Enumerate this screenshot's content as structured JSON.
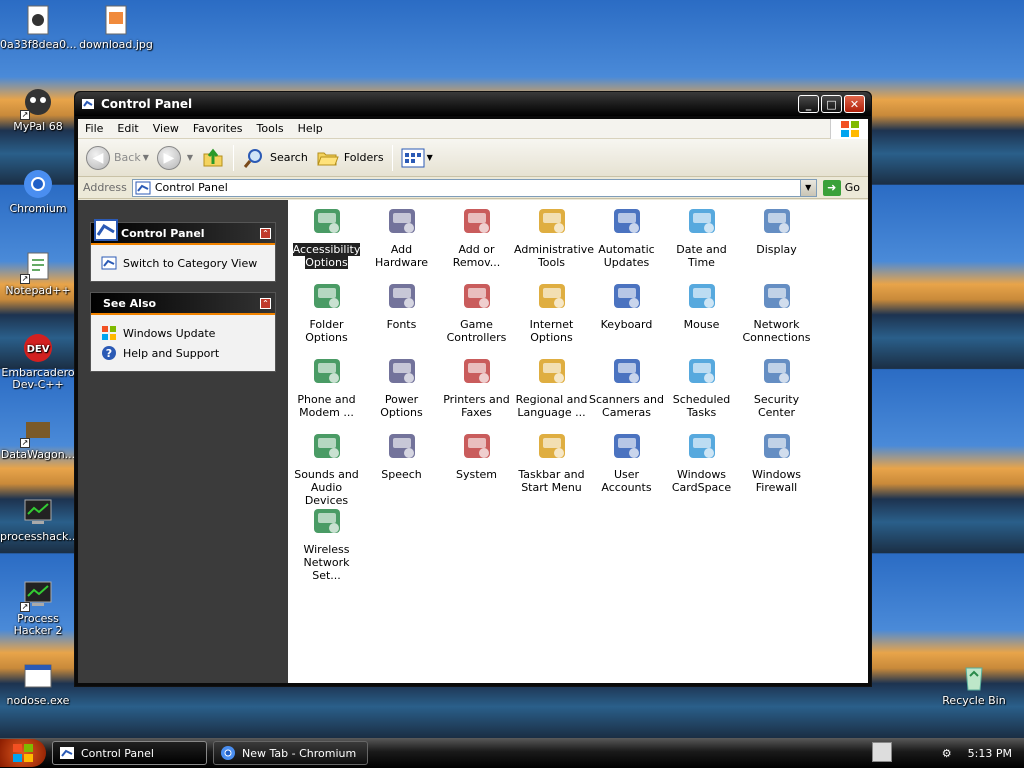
{
  "desktop": {
    "icons": [
      {
        "label": "0a33f8dea0...",
        "icon": "file-icon"
      },
      {
        "label": "download.jpg",
        "icon": "image-file-icon"
      },
      {
        "label": "MyPal 68",
        "icon": "mypal-icon"
      },
      {
        "label": "Chromium",
        "icon": "chromium-icon"
      },
      {
        "label": "Notepad++",
        "icon": "notepadpp-icon"
      },
      {
        "label": "Embarcadero Dev-C++",
        "icon": "devcpp-icon"
      },
      {
        "label": "DataWagon...",
        "icon": "datawagon-icon"
      },
      {
        "label": "processhack...",
        "icon": "processhacker-icon"
      },
      {
        "label": "Process Hacker 2",
        "icon": "processhacker2-icon"
      },
      {
        "label": "nodose.exe",
        "icon": "exe-icon"
      },
      {
        "label": "Recycle Bin",
        "icon": "recycle-bin-icon"
      }
    ]
  },
  "window": {
    "title": "Control Panel",
    "menu": [
      "File",
      "Edit",
      "View",
      "Favorites",
      "Tools",
      "Help"
    ],
    "toolbar": {
      "back": "Back",
      "search": "Search",
      "folders": "Folders"
    },
    "address": {
      "label": "Address",
      "value": "Control Panel",
      "go": "Go"
    },
    "taskpane": {
      "control_panel": {
        "title": "Control Panel",
        "link": "Switch to Category View"
      },
      "see_also": {
        "title": "See Also",
        "links": [
          "Windows Update",
          "Help and Support"
        ]
      }
    },
    "items": [
      {
        "label": "Accessibility Options",
        "icon": "accessibility-icon",
        "selected": true
      },
      {
        "label": "Add Hardware",
        "icon": "add-hardware-icon"
      },
      {
        "label": "Add or Remov...",
        "icon": "add-remove-programs-icon"
      },
      {
        "label": "Administrative Tools",
        "icon": "administrative-tools-icon"
      },
      {
        "label": "Automatic Updates",
        "icon": "automatic-updates-icon"
      },
      {
        "label": "Date and Time",
        "icon": "date-time-icon"
      },
      {
        "label": "Display",
        "icon": "display-icon"
      },
      {
        "label": "Folder Options",
        "icon": "folder-options-icon"
      },
      {
        "label": "Fonts",
        "icon": "fonts-icon"
      },
      {
        "label": "Game Controllers",
        "icon": "game-controllers-icon"
      },
      {
        "label": "Internet Options",
        "icon": "internet-options-icon"
      },
      {
        "label": "Keyboard",
        "icon": "keyboard-icon"
      },
      {
        "label": "Mouse",
        "icon": "mouse-icon"
      },
      {
        "label": "Network Connections",
        "icon": "network-connections-icon"
      },
      {
        "label": "Phone and Modem ...",
        "icon": "phone-modem-icon"
      },
      {
        "label": "Power Options",
        "icon": "power-options-icon"
      },
      {
        "label": "Printers and Faxes",
        "icon": "printers-faxes-icon"
      },
      {
        "label": "Regional and Language ...",
        "icon": "regional-language-icon"
      },
      {
        "label": "Scanners and Cameras",
        "icon": "scanners-cameras-icon"
      },
      {
        "label": "Scheduled Tasks",
        "icon": "scheduled-tasks-icon"
      },
      {
        "label": "Security Center",
        "icon": "security-center-icon"
      },
      {
        "label": "Sounds and Audio Devices",
        "icon": "sounds-audio-icon"
      },
      {
        "label": "Speech",
        "icon": "speech-icon"
      },
      {
        "label": "System",
        "icon": "system-icon"
      },
      {
        "label": "Taskbar and Start Menu",
        "icon": "taskbar-start-menu-icon"
      },
      {
        "label": "User Accounts",
        "icon": "user-accounts-icon"
      },
      {
        "label": "Windows CardSpace",
        "icon": "cardspace-icon"
      },
      {
        "label": "Windows Firewall",
        "icon": "firewall-icon"
      },
      {
        "label": "Wireless Network Set...",
        "icon": "wireless-network-icon"
      }
    ]
  },
  "taskbar": {
    "buttons": [
      "Control Panel",
      "New Tab - Chromium"
    ],
    "clock": "5:13 PM"
  }
}
